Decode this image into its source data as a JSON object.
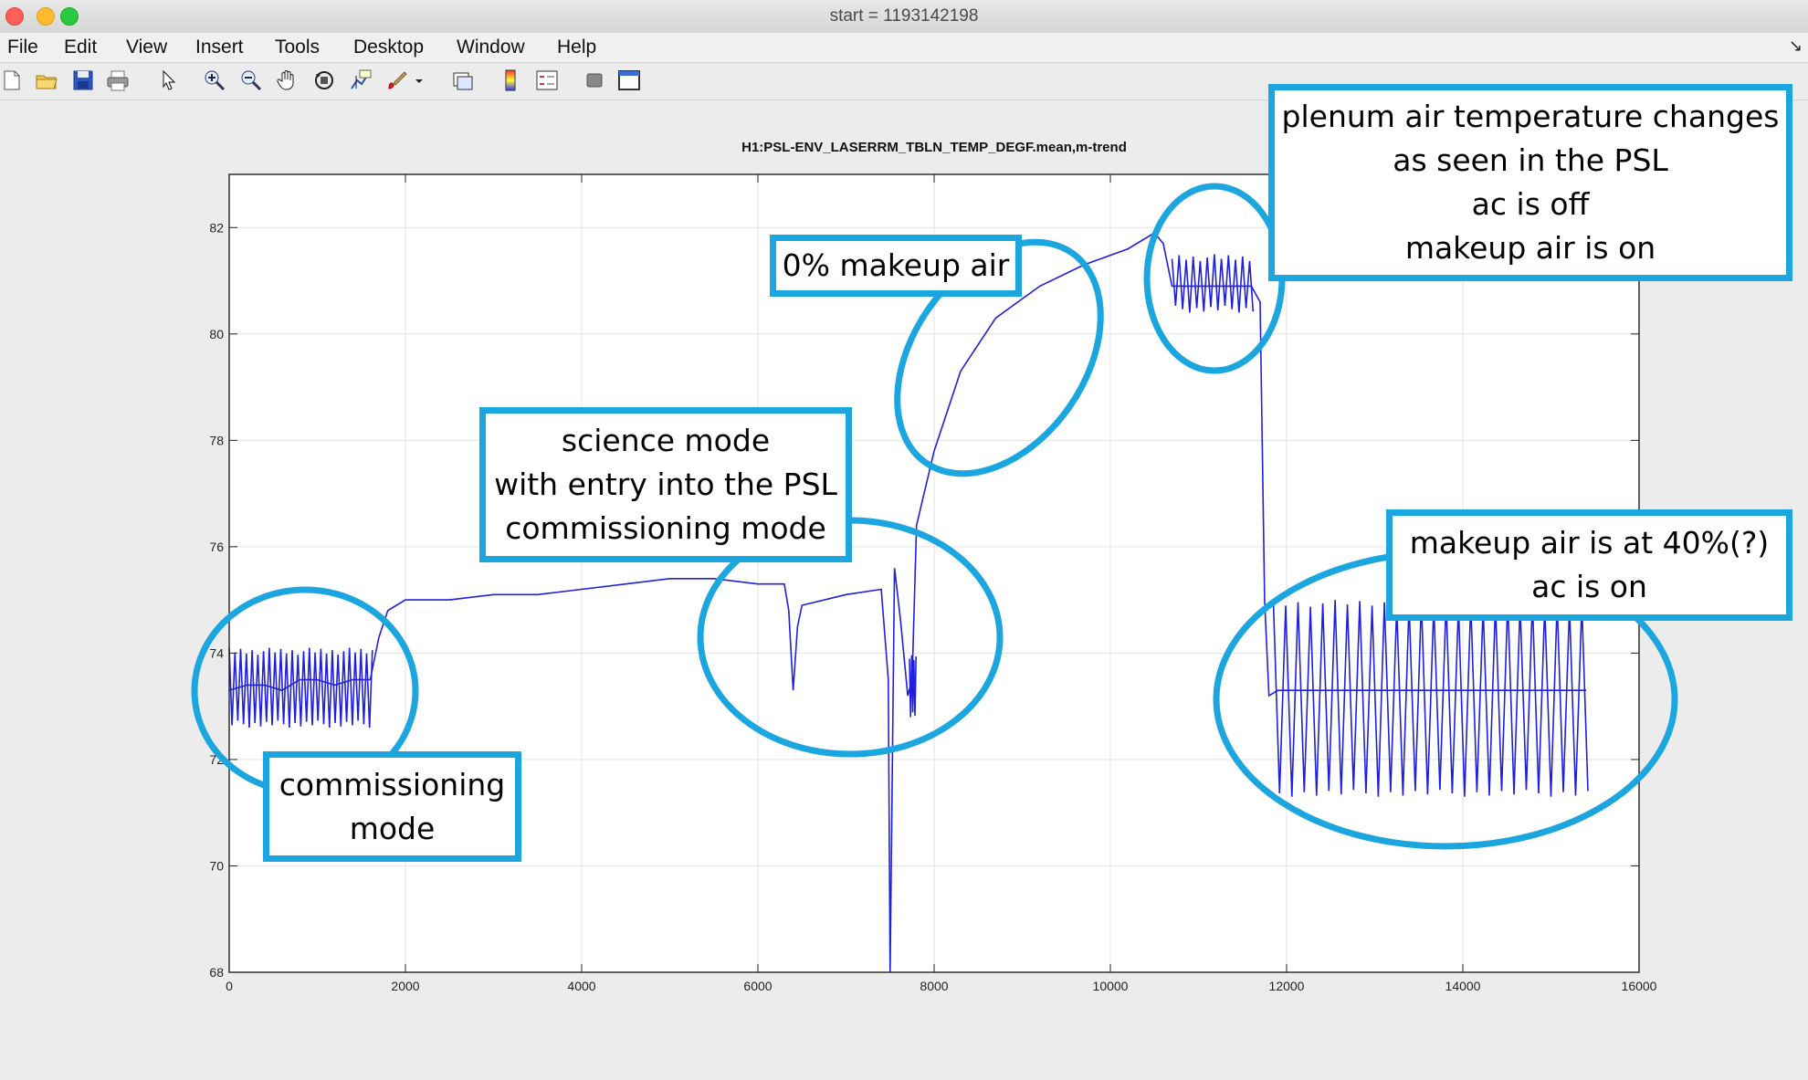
{
  "window": {
    "title": "start = 1193142198"
  },
  "menubar": {
    "items": [
      "File",
      "Edit",
      "View",
      "Insert",
      "Tools",
      "Desktop",
      "Window",
      "Help"
    ]
  },
  "toolbar": {
    "icons": [
      "new-file-icon",
      "open-folder-icon",
      "save-icon",
      "print-icon",
      "pointer-icon",
      "zoom-in-icon",
      "zoom-out-icon",
      "pan-hand-icon",
      "rotate-3d-icon",
      "data-cursor-icon",
      "brush-icon",
      "dropdown-arrow-icon",
      "link-plot-icon",
      "colorbar-icon",
      "legend-icon",
      "hide-tools-icon",
      "dock-figure-icon"
    ]
  },
  "chart_data": {
    "type": "line",
    "title": "H1:PSL-ENV_LASERRM_TBLN_TEMP_DEGF.mean,m-trend",
    "xlabel": "",
    "ylabel": "",
    "xlim": [
      0,
      16000
    ],
    "ylim": [
      68,
      83
    ],
    "xticks": [
      "0",
      "2000",
      "4000",
      "6000",
      "8000",
      "10000",
      "12000",
      "14000",
      "16000"
    ],
    "yticks": [
      "68",
      "70",
      "72",
      "74",
      "76",
      "78",
      "80",
      "82"
    ],
    "grid": true,
    "color": "#1f1fdd",
    "series": [
      {
        "name": "",
        "x": [
          0,
          200,
          400,
          600,
          800,
          1000,
          1200,
          1400,
          1600,
          1700,
          1800,
          2000,
          2500,
          3000,
          3500,
          4000,
          4500,
          5000,
          5500,
          6000,
          6300,
          6350,
          6400,
          6450,
          6500,
          7000,
          7400,
          7480,
          7500,
          7550,
          7620,
          7700,
          7750,
          7800,
          8000,
          8300,
          8700,
          9200,
          9700,
          10200,
          10500,
          10600,
          10700,
          11000,
          11300,
          11600,
          11700,
          11750,
          11800,
          11900,
          12300,
          12700,
          13100,
          13500,
          13900,
          14300,
          14700,
          15100,
          15400
        ],
        "y": [
          73.3,
          73.4,
          73.4,
          73.3,
          73.5,
          73.5,
          73.4,
          73.5,
          73.5,
          74.3,
          74.8,
          75.0,
          75.0,
          75.1,
          75.1,
          75.2,
          75.3,
          75.4,
          75.4,
          75.3,
          75.3,
          74.8,
          73.3,
          74.5,
          74.9,
          75.1,
          75.2,
          73.5,
          68.0,
          75.6,
          74.6,
          73.2,
          73.5,
          76.4,
          77.8,
          79.3,
          80.3,
          80.9,
          81.3,
          81.6,
          81.9,
          81.7,
          80.9,
          80.9,
          80.9,
          80.9,
          80.6,
          75.0,
          73.2,
          73.3,
          73.3,
          73.3,
          73.3,
          73.3,
          73.3,
          73.3,
          73.3,
          73.3,
          73.3
        ]
      }
    ],
    "oscillations": [
      {
        "x0": 0,
        "x1": 1650,
        "lo": 72.6,
        "hi": 74.1,
        "period": 65
      },
      {
        "x0": 10700,
        "x1": 11650,
        "lo": 80.4,
        "hi": 81.5,
        "period": 80
      },
      {
        "x0": 11850,
        "x1": 15450,
        "lo": 71.3,
        "hi": 75.0,
        "period": 140
      },
      {
        "x0": 7720,
        "x1": 7800,
        "lo": 72.8,
        "hi": 74.0,
        "period": 25
      }
    ]
  },
  "annotations": {
    "commissioning": "commissioning\nmode",
    "science": "science mode\nwith entry into the PSL\ncommissioning mode",
    "makeup0": "0% makeup air",
    "plenum": "plenum air temperature changes\nas seen in the PSL\nac is off\nmakeup air is on",
    "makeup40": "makeup air is at 40%(?)\nac is on"
  }
}
